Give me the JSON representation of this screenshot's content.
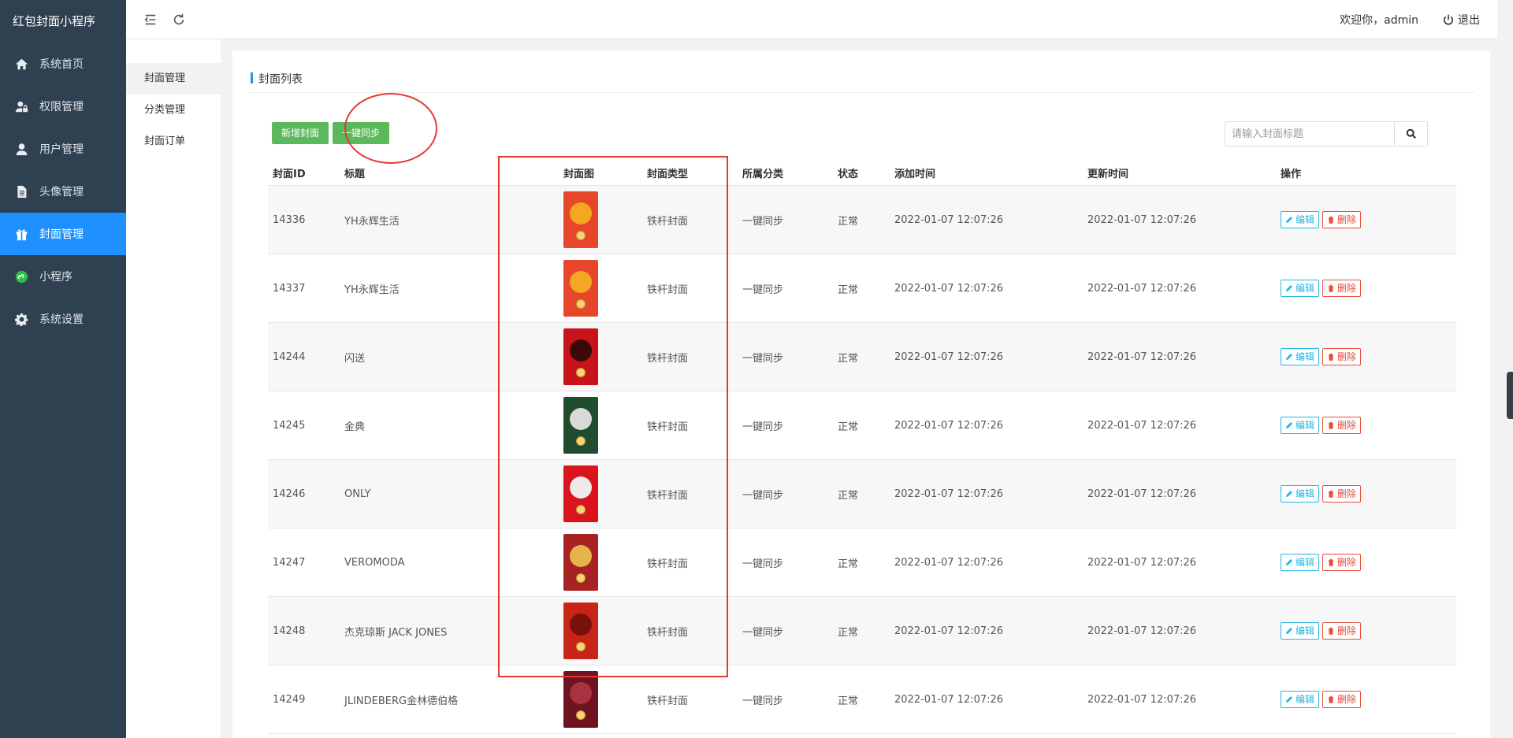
{
  "app": {
    "title": "红包封面小程序"
  },
  "sidebar": {
    "items": [
      {
        "label": "系统首页",
        "icon": "home-icon"
      },
      {
        "label": "权限管理",
        "icon": "user-lock-icon"
      },
      {
        "label": "用户管理",
        "icon": "user-icon"
      },
      {
        "label": "头像管理",
        "icon": "document-icon"
      },
      {
        "label": "封面管理",
        "icon": "gift-icon"
      },
      {
        "label": "小程序",
        "icon": "mini-program-icon"
      },
      {
        "label": "系统设置",
        "icon": "gear-icon"
      }
    ],
    "active_index": 4
  },
  "submenu": {
    "title": "封面管理",
    "items": [
      {
        "label": "封面管理"
      },
      {
        "label": "分类管理"
      },
      {
        "label": "封面订单"
      }
    ]
  },
  "topbar": {
    "welcome": "欢迎你，admin",
    "logout": "退出"
  },
  "card": {
    "title": "封面列表",
    "add_button": "新增封面",
    "sync_button": "一键同步",
    "search_placeholder": "请输入封面标题"
  },
  "table": {
    "headers": {
      "id": "封面ID",
      "title": "标题",
      "image": "封面图",
      "type": "封面类型",
      "category": "所属分类",
      "status": "状态",
      "added": "添加时间",
      "updated": "更新时间",
      "actions": "操作"
    },
    "edit_label": "编辑",
    "delete_label": "删除",
    "rows": [
      {
        "id": "14336",
        "title": "YH永辉生活",
        "type": "铁杆封面",
        "category": "一键同步",
        "status": "正常",
        "added": "2022-01-07 12:07:26",
        "updated": "2022-01-07 12:07:26"
      },
      {
        "id": "14337",
        "title": "YH永辉生活",
        "type": "铁杆封面",
        "category": "一键同步",
        "status": "正常",
        "added": "2022-01-07 12:07:26",
        "updated": "2022-01-07 12:07:26"
      },
      {
        "id": "14244",
        "title": "闪送",
        "type": "铁杆封面",
        "category": "一键同步",
        "status": "正常",
        "added": "2022-01-07 12:07:26",
        "updated": "2022-01-07 12:07:26"
      },
      {
        "id": "14245",
        "title": "金典",
        "type": "铁杆封面",
        "category": "一键同步",
        "status": "正常",
        "added": "2022-01-07 12:07:26",
        "updated": "2022-01-07 12:07:26"
      },
      {
        "id": "14246",
        "title": "ONLY",
        "type": "铁杆封面",
        "category": "一键同步",
        "status": "正常",
        "added": "2022-01-07 12:07:26",
        "updated": "2022-01-07 12:07:26"
      },
      {
        "id": "14247",
        "title": "VEROMODA",
        "type": "铁杆封面",
        "category": "一键同步",
        "status": "正常",
        "added": "2022-01-07 12:07:26",
        "updated": "2022-01-07 12:07:26"
      },
      {
        "id": "14248",
        "title": "杰克琼斯 JACK JONES",
        "type": "铁杆封面",
        "category": "一键同步",
        "status": "正常",
        "added": "2022-01-07 12:07:26",
        "updated": "2022-01-07 12:07:26"
      },
      {
        "id": "14249",
        "title": "JLINDEBERG金林德伯格",
        "type": "铁杆封面",
        "category": "一键同步",
        "status": "正常",
        "added": "2022-01-07 12:07:26",
        "updated": "2022-01-07 12:07:26"
      }
    ]
  },
  "thumb_colors": [
    {
      "bg": "#e8462b",
      "emb": "#f5a623"
    },
    {
      "bg": "#e8462b",
      "emb": "#f5a623"
    },
    {
      "bg": "#c8121c",
      "emb": "#3a0a0a"
    },
    {
      "bg": "#1f4d2e",
      "emb": "#d9d9d9"
    },
    {
      "bg": "#d9141c",
      "emb": "#f1e9e9"
    },
    {
      "bg": "#a72323",
      "emb": "#e6b34d"
    },
    {
      "bg": "#c92418",
      "emb": "#7a1209"
    },
    {
      "bg": "#6e1420",
      "emb": "#a8323e"
    }
  ]
}
